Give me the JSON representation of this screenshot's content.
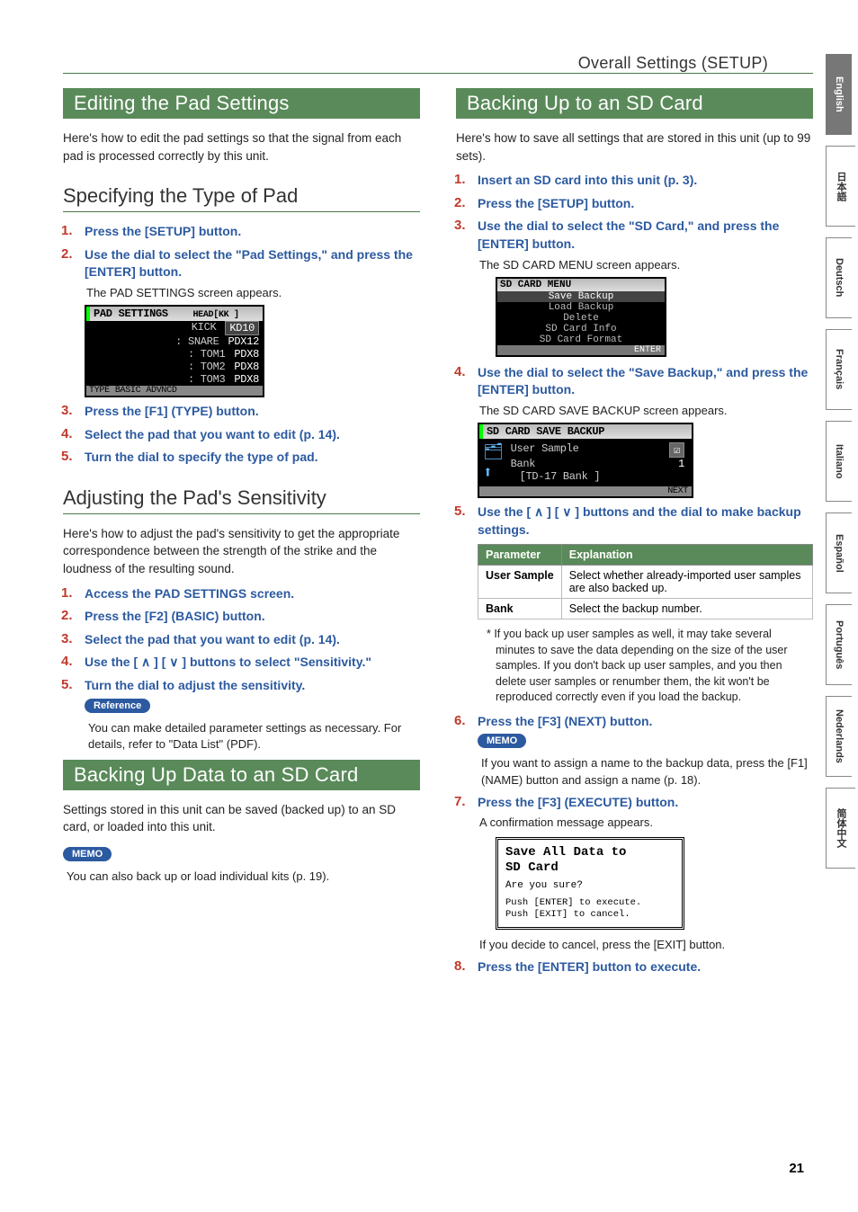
{
  "breadcrumb": "Overall Settings (SETUP)",
  "page_number": "21",
  "lang_tabs": [
    {
      "label": "English",
      "active": true
    },
    {
      "label": "日本語",
      "active": false
    },
    {
      "label": "Deutsch",
      "active": false
    },
    {
      "label": "Français",
      "active": false
    },
    {
      "label": "Italiano",
      "active": false
    },
    {
      "label": "Español",
      "active": false
    },
    {
      "label": "Português",
      "active": false
    },
    {
      "label": "Nederlands",
      "active": false
    },
    {
      "label": "简体中文",
      "active": false
    }
  ],
  "left": {
    "h1": "Editing the Pad Settings",
    "intro": "Here's how to edit the pad settings so that the signal from each pad is processed correctly by this unit.",
    "sec1": {
      "title": "Specifying the Type of Pad",
      "steps": {
        "s1": "Press the [SETUP] button.",
        "s2": "Use the dial to select the \"Pad Settings,\" and press the [ENTER] button.",
        "s2sub": "The PAD SETTINGS screen appears.",
        "s3": "Press the [F1] (TYPE) button.",
        "s4": "Select the pad that you want to edit (p. 14).",
        "s5": "Turn the dial to specify the type of pad."
      },
      "screen": {
        "title": "PAD SETTINGS",
        "head_r": "HEAD[KK ]",
        "rows": [
          {
            "l": "KICK",
            "r": "KD10"
          },
          {
            "l": "SNARE",
            "r": "PDX12"
          },
          {
            "l": "TOM1",
            "r": "PDX8"
          },
          {
            "l": "TOM2",
            "r": "PDX8"
          },
          {
            "l": "TOM3",
            "r": "PDX8"
          }
        ],
        "tabs": [
          "TYPE",
          "BASIC",
          "ADVNCD"
        ]
      }
    },
    "sec2": {
      "title": "Adjusting the Pad's Sensitivity",
      "intro": "Here's how to adjust the pad's sensitivity to get the appropriate correspondence between the strength of the strike and the loudness of the resulting sound.",
      "steps": {
        "s1": "Access the PAD SETTINGS screen.",
        "s2": "Press the [F2] (BASIC) button.",
        "s3": "Select the pad that you want to edit (p. 14).",
        "s4": "Use the [ ∧ ] [ ∨ ] buttons to select \"Sensitivity.\"",
        "s5": "Turn the dial to adjust the sensitivity."
      },
      "ref_badge": "Reference",
      "ref_text": "You can make detailed parameter settings as necessary. For details, refer to \"Data List\" (PDF)."
    },
    "sec3": {
      "title": "Backing Up Data to an SD Card",
      "intro": "Settings stored in this unit can be saved (backed up) to an SD card, or loaded into this unit.",
      "memo_badge": "MEMO",
      "memo_text": "You can also back up or load individual kits (p. 19)."
    }
  },
  "right": {
    "h1": "Backing Up to an SD Card",
    "intro": "Here's how to save all settings that are stored in this unit (up to 99 sets).",
    "steps": {
      "s1": "Insert an SD card into this unit (p. 3).",
      "s2": "Press the [SETUP] button.",
      "s3": "Use the dial to select the \"SD Card,\" and press the [ENTER] button.",
      "s3sub": "The SD CARD MENU screen appears.",
      "s4": "Use the dial to select the \"Save Backup,\" and press the [ENTER] button.",
      "s4sub": "The SD CARD SAVE BACKUP screen appears.",
      "s5": "Use the [ ∧ ] [ ∨ ] buttons and the dial to make backup settings.",
      "s6": "Press the [F3] (NEXT) button.",
      "s6memo_badge": "MEMO",
      "s6memo": "If you want to assign a name to the backup data, press the [F1] (NAME) button and assign a name (p. 18).",
      "s7": "Press the [F3] (EXECUTE) button.",
      "s7sub": "A confirmation message appears.",
      "s7after": "If you decide to cancel, press the [EXIT] button.",
      "s8": "Press the [ENTER] button to execute."
    },
    "menu_screen": {
      "title": "SD CARD MENU",
      "items": [
        "Save Backup",
        "Load Backup",
        "Delete",
        "SD Card Info",
        "SD Card Format"
      ],
      "footer": "ENTER"
    },
    "save_screen": {
      "title": "SD CARD SAVE BACKUP",
      "rows": {
        "user_sample": "User Sample",
        "user_sample_val": "☑",
        "bank": "Bank",
        "bank_val": "1",
        "bankline": "[TD-17 Bank   ]"
      },
      "footer": "NEXT"
    },
    "table": {
      "h1": "Parameter",
      "h2": "Explanation",
      "r1p": "User Sample",
      "r1e": "Select whether already-imported user samples are also backed up.",
      "r2p": "Bank",
      "r2e": "Select the backup number."
    },
    "asterisk": "*  If you back up user samples as well, it may take several minutes to save the data depending on the size of the user samples. If you don't back up user samples, and you then delete user samples or renumber them, the kit won't be reproduced correctly even if you load the backup.",
    "confirm": {
      "l1": "Save All Data to",
      "l2": "SD Card",
      "l3": "Are you sure?",
      "l4": "Push [ENTER] to execute.",
      "l5": "Push [EXIT] to cancel."
    }
  }
}
